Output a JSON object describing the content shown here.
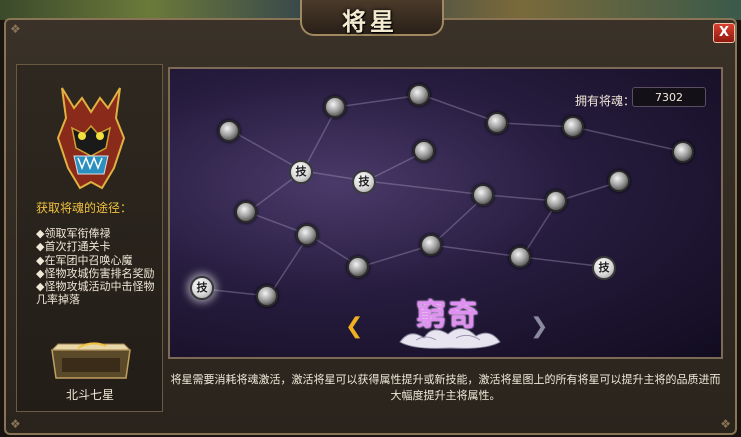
{
  "window": {
    "title": "将星",
    "close_label": "X"
  },
  "left_panel": {
    "ways_title": "获取将魂的途径：",
    "ways": [
      "◆领取军衔俸禄",
      "◆首次打通关卡",
      "◆在军团中召唤心魔",
      "◆怪物攻城伤害排名奖励",
      "◆怪物攻城活动中击怪物几率掉落"
    ],
    "book_label": "北斗七星"
  },
  "map": {
    "soul_label": "拥有将魂：",
    "soul_value": "7302",
    "skill_label": "技",
    "constellation_name": "窮奇",
    "description": "将星需要消耗将魂激活，激活将星可以获得属性提升或新技能，激活将星图上的所有将星可以提升主将的品质进而大幅度提升主将属性。"
  },
  "colors": {
    "accent_gold": "#f0c040",
    "constellation_purple": "#e090f0",
    "close_red": "#d84030"
  }
}
